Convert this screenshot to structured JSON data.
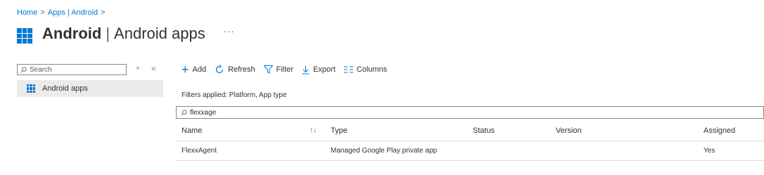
{
  "breadcrumb": {
    "home": "Home",
    "apps": "Apps | Android",
    "sep": ">"
  },
  "header": {
    "title_bold": "Android",
    "title_sep": "|",
    "title_rest": "Android apps",
    "more": "···"
  },
  "leftnav": {
    "search_placeholder": "Search",
    "clear_icon": "×",
    "collapse_icon": "«",
    "items": [
      {
        "label": "Android apps"
      }
    ]
  },
  "toolbar": {
    "add": "Add",
    "refresh": "Refresh",
    "filter": "Filter",
    "export": "Export",
    "columns": "Columns"
  },
  "filters_applied": "Filters applied: Platform, App type",
  "filter_input_value": "flexxage",
  "table": {
    "columns": [
      "Name",
      "Type",
      "Status",
      "Version",
      "Assigned"
    ],
    "rows": [
      {
        "name": "FlexxAgent",
        "type": "Managed Google Play private app",
        "status": "",
        "version": "",
        "assigned": "Yes"
      }
    ]
  },
  "colors": {
    "accent": "#0078d4",
    "selected_bg": "#edebe9"
  }
}
